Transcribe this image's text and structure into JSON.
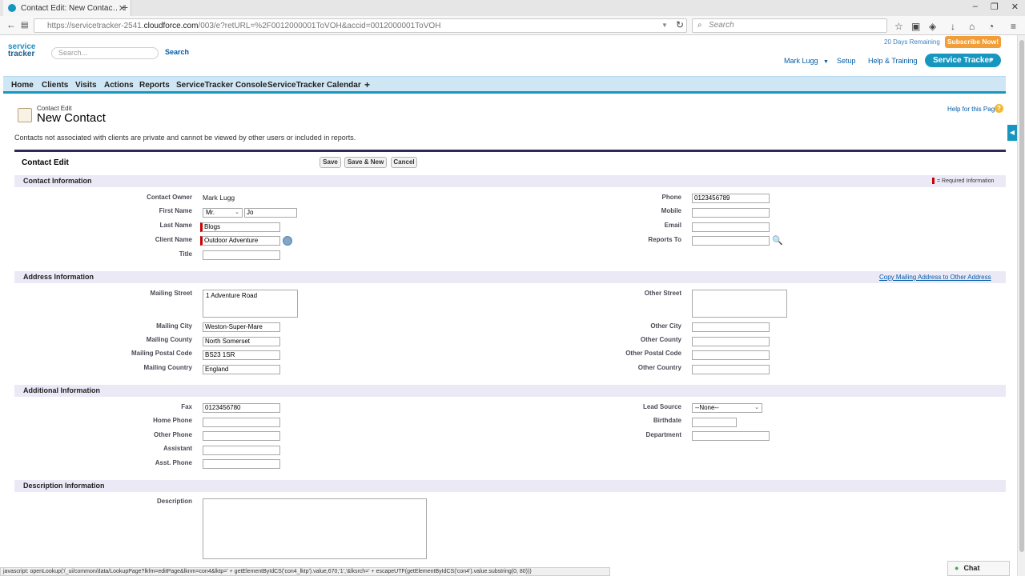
{
  "browser": {
    "tab_title": "Contact Edit: New Contac…",
    "url_prefix": "https://servicetracker-2541.",
    "url_host": "cloudforce.com",
    "url_rest": "/003/e?retURL=%2F0012000001ToVOH&accid=0012000001ToVOH",
    "search_placeholder": "Search"
  },
  "header": {
    "logo_line1": "service",
    "logo_line2": "tracker",
    "search_placeholder": "Search...",
    "search_button": "Search",
    "trial_text": "20 Days Remaining",
    "subscribe_button": "Subscribe Now!",
    "user_menu": "Mark Lugg",
    "setup_link": "Setup",
    "help_link": "Help & Training",
    "app_menu": "Service Tracker"
  },
  "nav_tabs": [
    "Home",
    "Clients",
    "Visits",
    "Actions",
    "Reports",
    "ServiceTracker Console",
    "ServiceTracker Calendar",
    "+"
  ],
  "page": {
    "subtitle": "Contact Edit",
    "title": "New Contact",
    "help_link": "Help for this Page",
    "notice": "Contacts not associated with clients are private and cannot be viewed by other users or included in reports."
  },
  "form": {
    "heading": "Contact Edit",
    "save": "Save",
    "save_new": "Save & New",
    "cancel": "Cancel",
    "required_info": "= Required Information",
    "sections": {
      "contact": "Contact Information",
      "address": "Address Information",
      "additional": "Additional Information",
      "description": "Description Information"
    },
    "copy_address_link": "Copy Mailing Address to Other Address",
    "contact": {
      "owner_label": "Contact Owner",
      "owner_value": "Mark Lugg",
      "first_name_label": "First Name",
      "salutation": "Mr.",
      "first_name": "Jo",
      "last_name_label": "Last Name",
      "last_name": "Blogs",
      "client_name_label": "Client Name",
      "client_name": "Outdoor Adventure",
      "title_label": "Title",
      "title": "",
      "phone_label": "Phone",
      "phone": "0123456789",
      "mobile_label": "Mobile",
      "mobile": "",
      "email_label": "Email",
      "email": "",
      "reports_to_label": "Reports To",
      "reports_to": ""
    },
    "address": {
      "mailing_street_label": "Mailing Street",
      "mailing_street": "1 Adventure Road",
      "mailing_city_label": "Mailing City",
      "mailing_city": "Weston-Super-Mare",
      "mailing_county_label": "Mailing County",
      "mailing_county": "North Somerset",
      "mailing_postal_label": "Mailing Postal Code",
      "mailing_postal": "BS23 1SR",
      "mailing_country_label": "Mailing Country",
      "mailing_country": "England",
      "other_street_label": "Other Street",
      "other_street": "",
      "other_city_label": "Other City",
      "other_city": "",
      "other_county_label": "Other County",
      "other_county": "",
      "other_postal_label": "Other Postal Code",
      "other_postal": "",
      "other_country_label": "Other Country",
      "other_country": ""
    },
    "additional": {
      "fax_label": "Fax",
      "fax": "0123456780",
      "home_phone_label": "Home Phone",
      "home_phone": "",
      "other_phone_label": "Other Phone",
      "other_phone": "",
      "assistant_label": "Assistant",
      "assistant": "",
      "asst_phone_label": "Asst. Phone",
      "asst_phone": "",
      "lead_source_label": "Lead Source",
      "lead_source": "--None--",
      "birthdate_label": "Birthdate",
      "birthdate": "",
      "department_label": "Department",
      "department": ""
    },
    "description": {
      "label": "Description",
      "value": ""
    }
  },
  "status_bar": "javascript: openLookup('/_ui/common/data/LookupPage?lkfm=editPage&lknm=con4&lktp=' + getElementByIdCS('con4_lktp').value,670,'1','&lksrch=' + escapeUTF(getElementByIdCS('con4').value.substring(0, 80)))",
  "chat_label": "Chat",
  "colors": {
    "accent": "#1797c0",
    "required": "#cc0000",
    "section_bg": "#ece9f7",
    "subscribe": "#f19d38"
  }
}
